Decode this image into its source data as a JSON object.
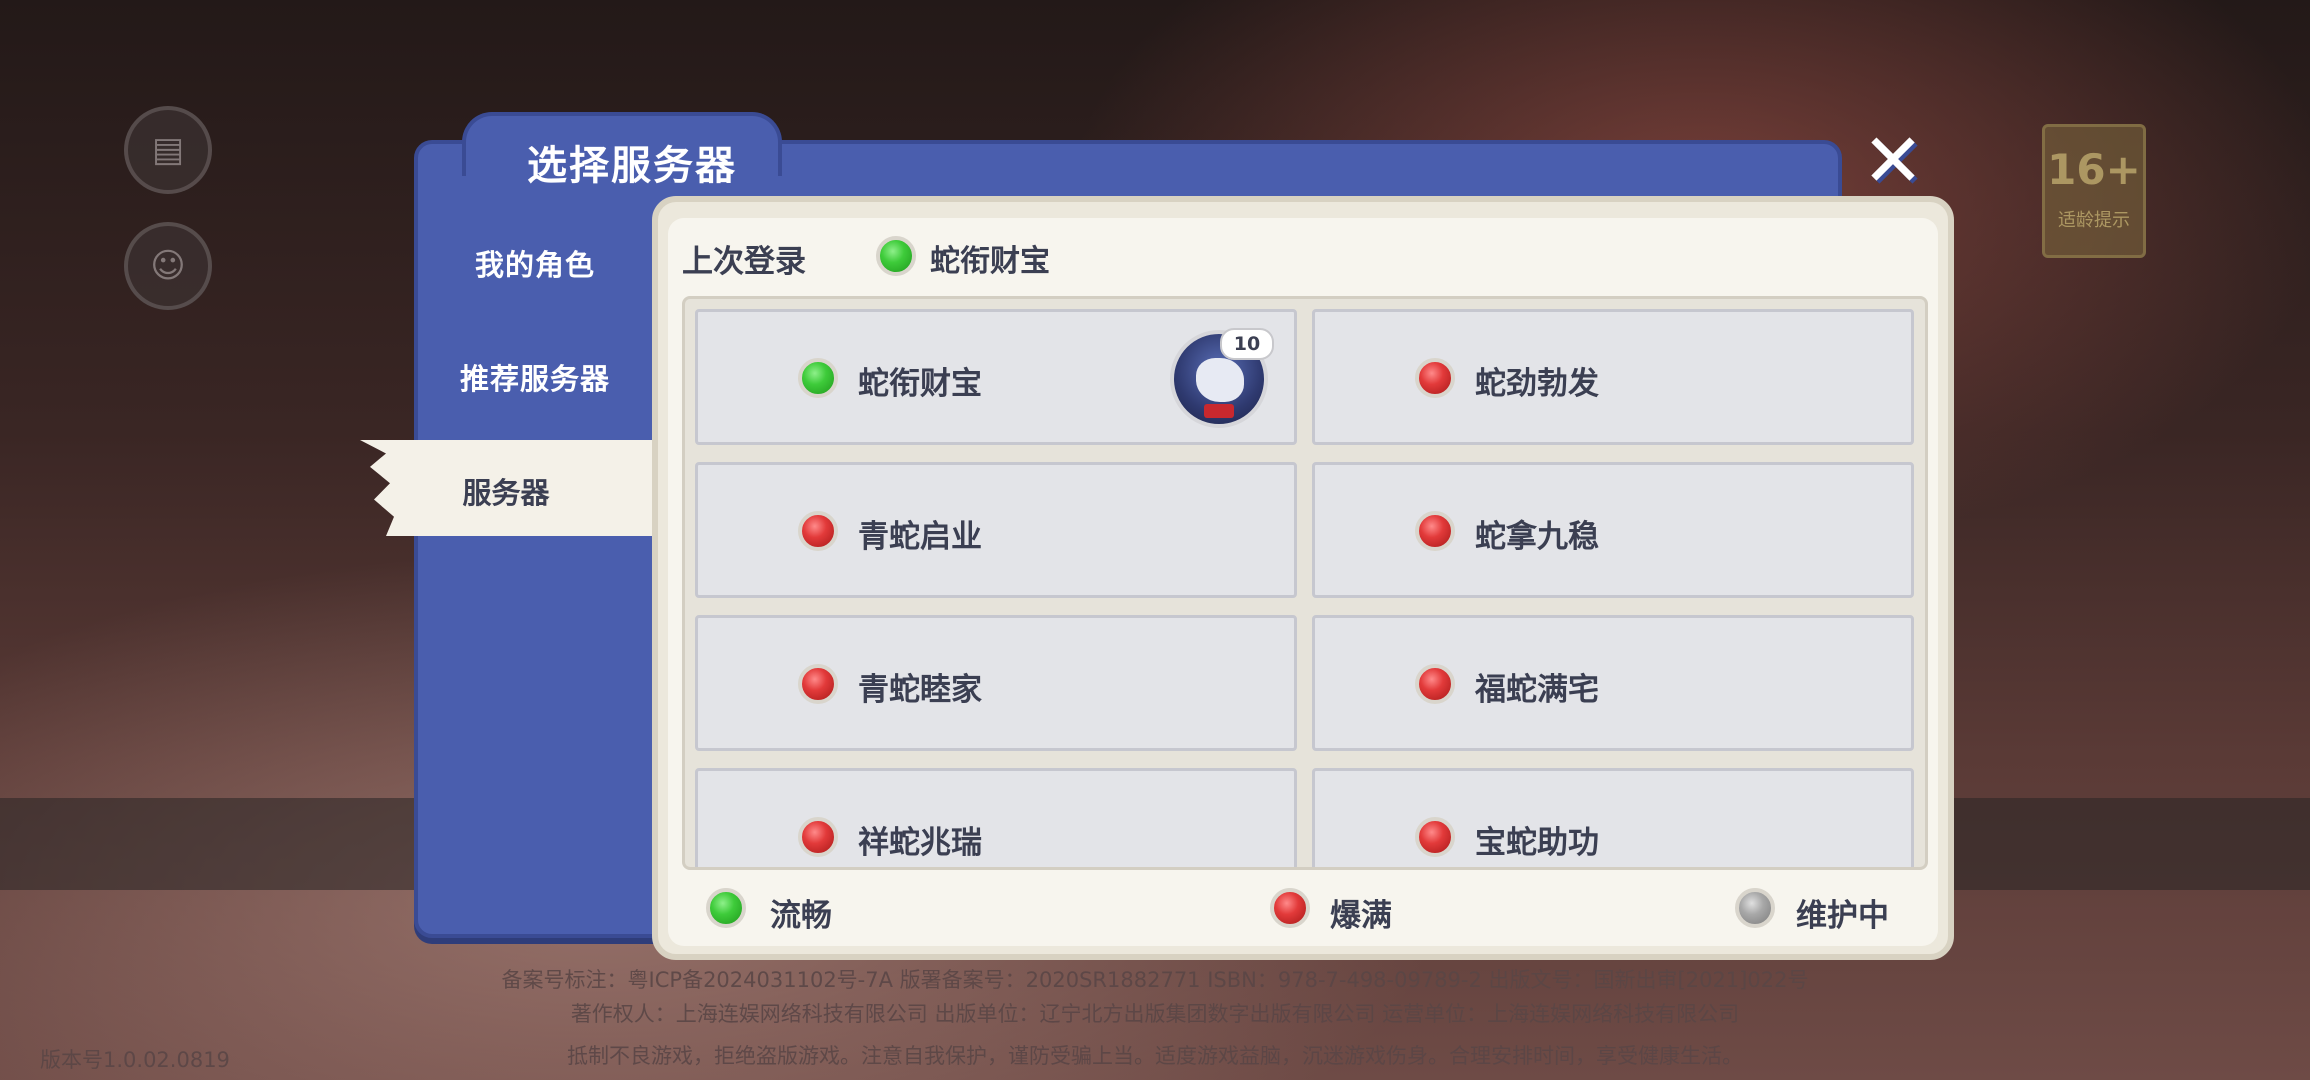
{
  "dialog": {
    "title": "选择服务器",
    "nav": [
      {
        "label": "我的角色"
      },
      {
        "label": "推荐服务器"
      },
      {
        "label": "服务器"
      }
    ]
  },
  "last_login": {
    "label": "上次登录",
    "server_name": "蛇衔财宝",
    "status": "green"
  },
  "servers": [
    {
      "name": "蛇衔财宝",
      "status": "green",
      "avatar_level": "10"
    },
    {
      "name": "蛇劲勃发",
      "status": "red"
    },
    {
      "name": "青蛇启业",
      "status": "red"
    },
    {
      "name": "蛇拿九稳",
      "status": "red"
    },
    {
      "name": "青蛇睦家",
      "status": "red"
    },
    {
      "name": "福蛇满宅",
      "status": "red"
    },
    {
      "name": "祥蛇兆瑞",
      "status": "red"
    },
    {
      "name": "宝蛇助功",
      "status": "red"
    }
  ],
  "legend": [
    {
      "label": "流畅",
      "status": "green"
    },
    {
      "label": "爆满",
      "status": "red"
    },
    {
      "label": "维护中",
      "status": "gray"
    }
  ],
  "background": {
    "age_badge": {
      "number": "16+",
      "text": "适龄提示"
    },
    "footer_lines": [
      "备案号标注：粤ICP备2024031102号-7A 版署备案号：2020SR1882771 ISBN：978-7-498-09789-2 出版文号：国新出审[2021]022号",
      "著作权人：上海连娱网络科技有限公司 出版单位：辽宁北方出版集团数字出版有限公司 运营单位：上海连娱网络科技有限公司",
      "抵制不良游戏，拒绝盗版游戏。注意自我保护，谨防受骗上当。适度游戏益脑，沉迷游戏伤身。合理安排时间，享受健康生活。"
    ],
    "version": "版本号1.0.02.0819"
  },
  "colors": {
    "dialog_blue": "#4a5eae",
    "panel_cream": "#f7f5ee",
    "text_dark": "#3b3f52",
    "status_green": "#3ecb3a",
    "status_red": "#e23a3a",
    "status_gray": "#a8a8a8"
  },
  "icons": {
    "close": "close-x-icon",
    "notice": "notice-icon",
    "friends": "friends-icon"
  }
}
